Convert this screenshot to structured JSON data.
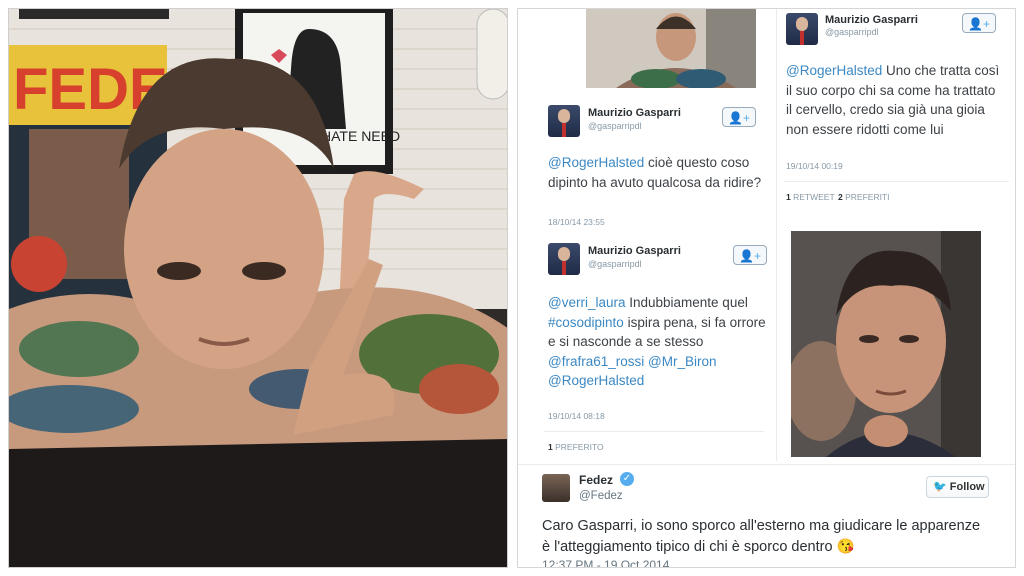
{
  "left_photo": {
    "poster_text": "FEDEZ",
    "wall_poster_text": "HATE NEED"
  },
  "tweets": [
    {
      "name": "Maurizio Gasparri",
      "handle": "@gasparripdl",
      "text_mention": "@RogerHalsted",
      "text_body": " cioè questo coso dipinto ha avuto qualcosa da ridire?",
      "timestamp": "18/10/14 23:55"
    },
    {
      "name": "Maurizio Gasparri",
      "handle": "@gasparripdl",
      "text_mention": "@verri_laura",
      "text_body": " Indubbiamente quel",
      "text_hashtag": "#cosodipinto",
      "text_body2": " ispira pena, si fa orrore e si nasconde a se stesso",
      "text_mentions_tail": [
        "@frafra61_rossi",
        "@Mr_Biron",
        "@RogerHalsted"
      ],
      "timestamp": "19/10/14 08:18",
      "favorites_count": "1",
      "favorites_label": "PREFERITO"
    },
    {
      "name": "Maurizio Gasparri",
      "handle": "@gasparripdl",
      "text_mention": "@RogerHalsted",
      "text_body": " Uno che tratta così il suo corpo chi sa come ha trattato il cervello, credo sia già una gioia non essere ridotti come lui",
      "timestamp": "19/10/14 00:19",
      "retweets_count": "1",
      "retweets_label": "RETWEET",
      "favorites_count": "2",
      "favorites_label": "PREFERITI"
    }
  ],
  "fedez_tweet": {
    "name": "Fedez",
    "handle": "@Fedez",
    "follow_label": "Follow",
    "text": "Caro Gasparri, io sono sporco all'esterno ma giudicare le apparenze è l'atteggiamento tipico di chi è sporco dentro 😘",
    "timestamp": "12:37 PM - 19 Oct 2014"
  },
  "icons": {
    "follow_user": "add-user-icon",
    "twitter_bird": "twitter-bird-icon",
    "verified": "verified-badge-icon"
  },
  "colors": {
    "mention": "#3b88c3",
    "meta": "#8899a6",
    "twitter_blue": "#55acee"
  }
}
